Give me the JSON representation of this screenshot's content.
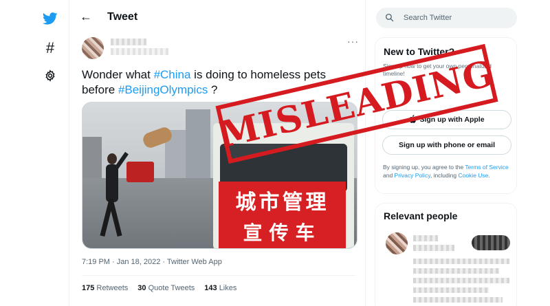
{
  "header": {
    "title": "Tweet",
    "back_glyph": "←"
  },
  "nav": {
    "items": [
      {
        "icon": "twitter-bird-icon"
      },
      {
        "icon": "hashtag-icon",
        "glyph": "#"
      },
      {
        "icon": "settings-gear-icon"
      }
    ]
  },
  "tweet": {
    "text_before": "Wonder what ",
    "hashtag_1": "#China",
    "text_middle": " is doing to homeless pets before ",
    "hashtag_2": "#BeijingOlympics",
    "text_after": " ?",
    "more_glyph": "···",
    "image": {
      "sign_line_1": "城市管理",
      "sign_line_2": "宣传车"
    },
    "meta": "7:19 PM · Jan 18, 2022 · Twitter Web App",
    "stats": {
      "retweets_count": "175",
      "retweets_label": "Retweets",
      "quotes_count": "30",
      "quotes_label": "Quote Tweets",
      "likes_count": "143",
      "likes_label": "Likes"
    }
  },
  "search": {
    "placeholder": "Search Twitter"
  },
  "new_to_twitter": {
    "title": "New to Twitter?",
    "description": "Sign up now to get your own personalized timeline!",
    "apple_button": "Sign up with Apple",
    "phone_button": "Sign up with phone or email",
    "terms_prefix": "By signing up, you agree to the ",
    "terms_link": "Terms of Service",
    "terms_and": " and ",
    "privacy_link": "Privacy Policy",
    "terms_including": ", including ",
    "cookie_link": "Cookie Use",
    "terms_end": "."
  },
  "relevant_people": {
    "title": "Relevant people"
  },
  "stamp": {
    "text": "MISLEADING"
  },
  "colors": {
    "accent": "#1d9bf0",
    "stamp": "#d51b1f",
    "text": "#0f1419",
    "muted": "#536471"
  }
}
